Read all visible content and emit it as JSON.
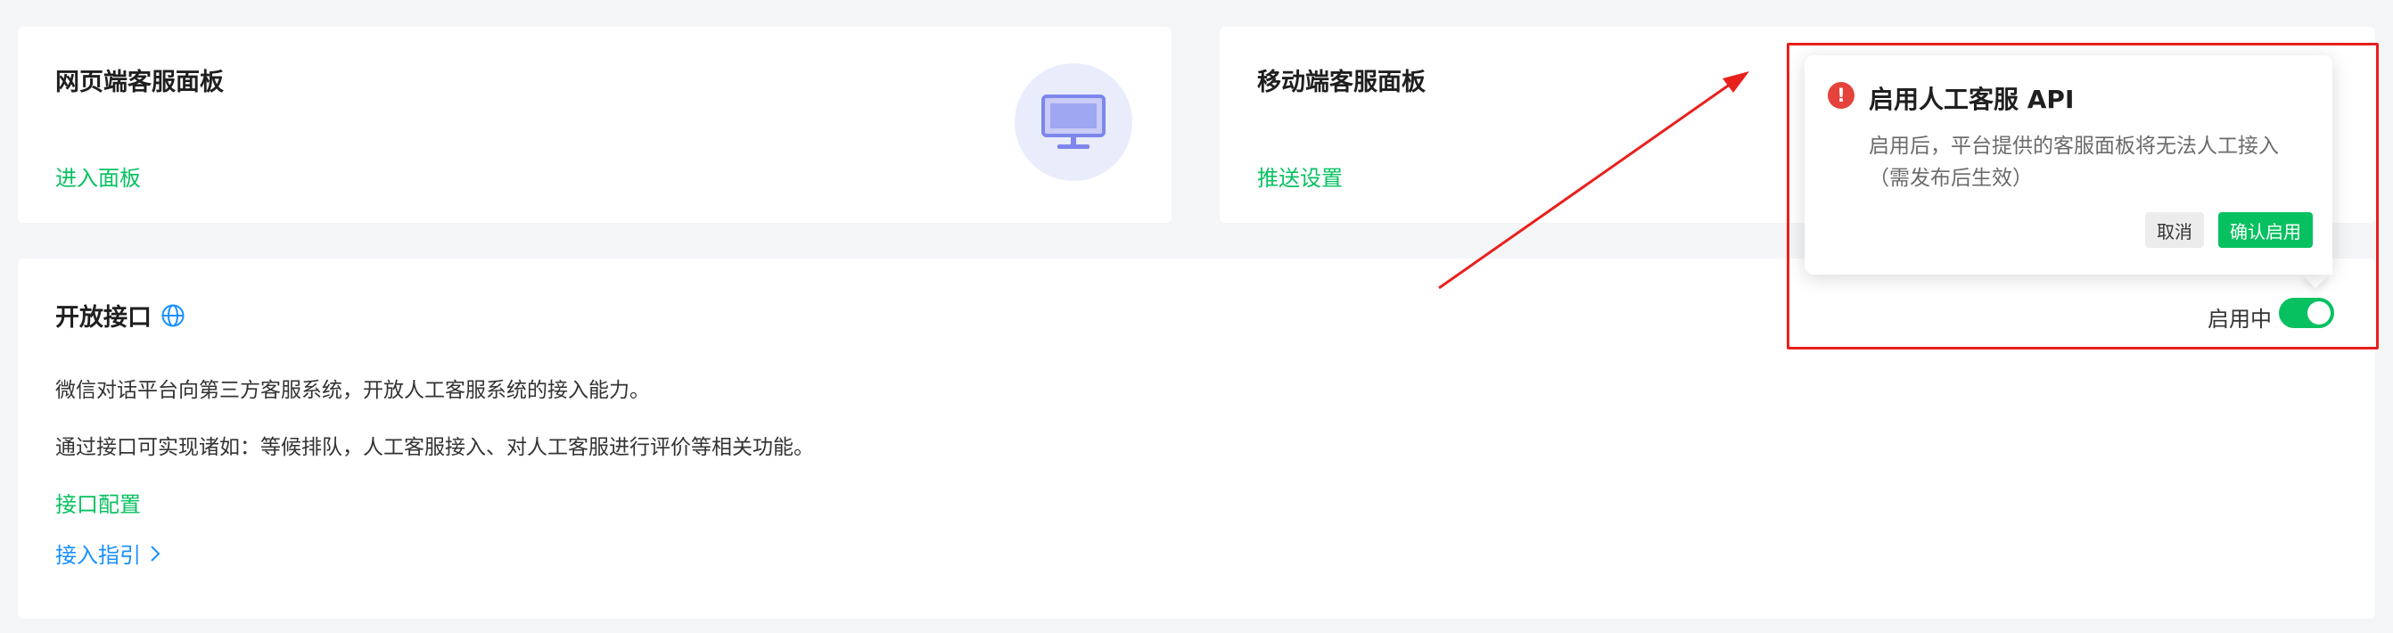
{
  "web_panel": {
    "title": "网页端客服面板",
    "link": "进入面板",
    "icon": "monitor-icon"
  },
  "mobile_panel": {
    "title": "移动端客服面板",
    "link": "推送设置"
  },
  "open_api": {
    "title": "开放接口",
    "title_icon": "globe-icon",
    "desc1": "微信对话平台向第三方客服系统，开放人工客服系统的接入能力。",
    "desc2": "通过接口可实现诸如：等候排队，人工客服接入、对人工客服进行评价等相关功能。",
    "config_link": "接口配置",
    "guide_link": "接入指引",
    "guide_icon": "chevron-right-icon",
    "status_label": "启用中",
    "toggle_on": true
  },
  "popconfirm": {
    "icon": "exclamation-icon",
    "title": "启用人工客服 API",
    "line1": "启用后，平台提供的客服面板将无法人工接入",
    "line2": "（需发布后生效）",
    "cancel_label": "取消",
    "confirm_label": "确认启用"
  },
  "colors": {
    "accent_green": "#07c160",
    "link_blue": "#1890ff",
    "annotation_red": "#e8201c",
    "warning_red": "#e5423b"
  }
}
